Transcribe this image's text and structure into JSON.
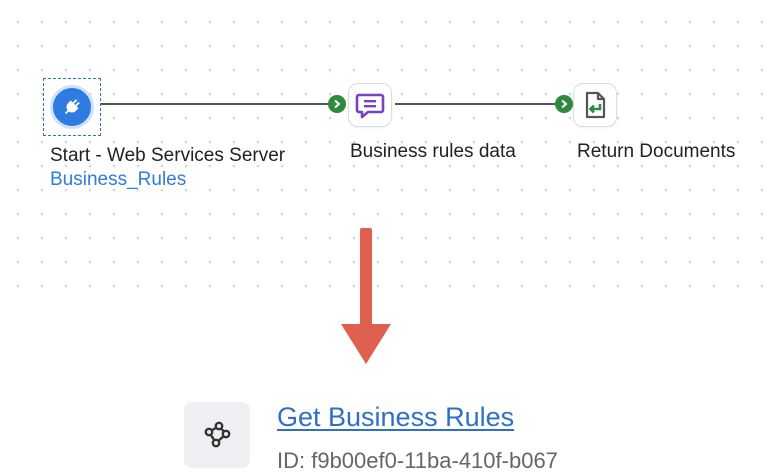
{
  "canvas": {
    "nodes": [
      {
        "label": "Start - Web Services Server",
        "sublabel": "Business_Rules",
        "icon": "plug-icon",
        "color": "#2f7be0"
      },
      {
        "label": "Business rules data",
        "icon": "message-icon",
        "color": "#7b3fc4"
      },
      {
        "label": "Return Documents",
        "icon": "return-document-icon",
        "color": "#2e8b3e"
      }
    ],
    "port_color": "#2e8b3e"
  },
  "arrow": {
    "icon": "down-arrow-icon",
    "color": "#e0604f"
  },
  "process": {
    "title": "Get Business Rules",
    "id_text": "ID: f9b00ef0-11ba-410f-b067",
    "icon": "process-graph-icon"
  }
}
